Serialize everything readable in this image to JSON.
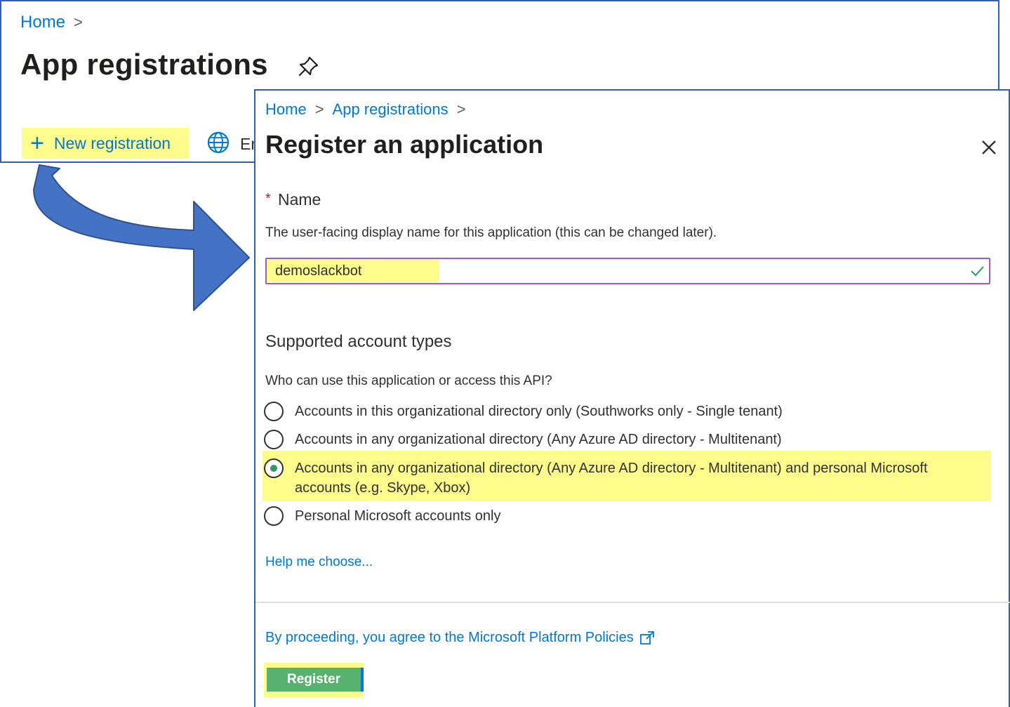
{
  "back": {
    "breadcrumb_home": "Home",
    "breadcrumb_sep": ">",
    "title": "App registrations",
    "pin_icon": "pin-icon",
    "new_registration_label": "New registration",
    "new_registration_plus": "+",
    "globe_icon": "globe-icon",
    "next_command_partial": "Er"
  },
  "arrow": {
    "color": "#4472c4",
    "border": "#2f528f"
  },
  "dialog": {
    "breadcrumb": {
      "home": "Home",
      "sep": ">",
      "app_registrations": "App registrations"
    },
    "title": "Register an application",
    "close_icon": "close-icon",
    "name": {
      "required_mark": "*",
      "label": "Name",
      "description": "The user-facing display name for this application (this can be changed later).",
      "value": "demoslackbot",
      "valid_icon": "checkmark-icon"
    },
    "account_types": {
      "heading": "Supported account types",
      "question": "Who can use this application or access this API?",
      "options": [
        {
          "label": "Accounts in this organizational directory only (Southworks only - Single tenant)",
          "selected": false
        },
        {
          "label": "Accounts in any organizational directory (Any Azure AD directory - Multitenant)",
          "selected": false
        },
        {
          "label": "Accounts in any organizational directory (Any Azure AD directory - Multitenant) and personal Microsoft accounts (e.g. Skype, Xbox)",
          "selected": true
        },
        {
          "label": "Personal Microsoft accounts only",
          "selected": false
        }
      ],
      "help_link": "Help me choose..."
    },
    "policy_link": "By proceeding, you agree to the Microsoft Platform Policies",
    "external_icon": "external-link-icon",
    "register_button": "Register"
  },
  "colors": {
    "link": "#0078d4",
    "highlight": "#fefc8a",
    "selected_radio": "#2e9b60",
    "register_bg": "#58b26f",
    "panel_border": "#2f5fb3"
  }
}
